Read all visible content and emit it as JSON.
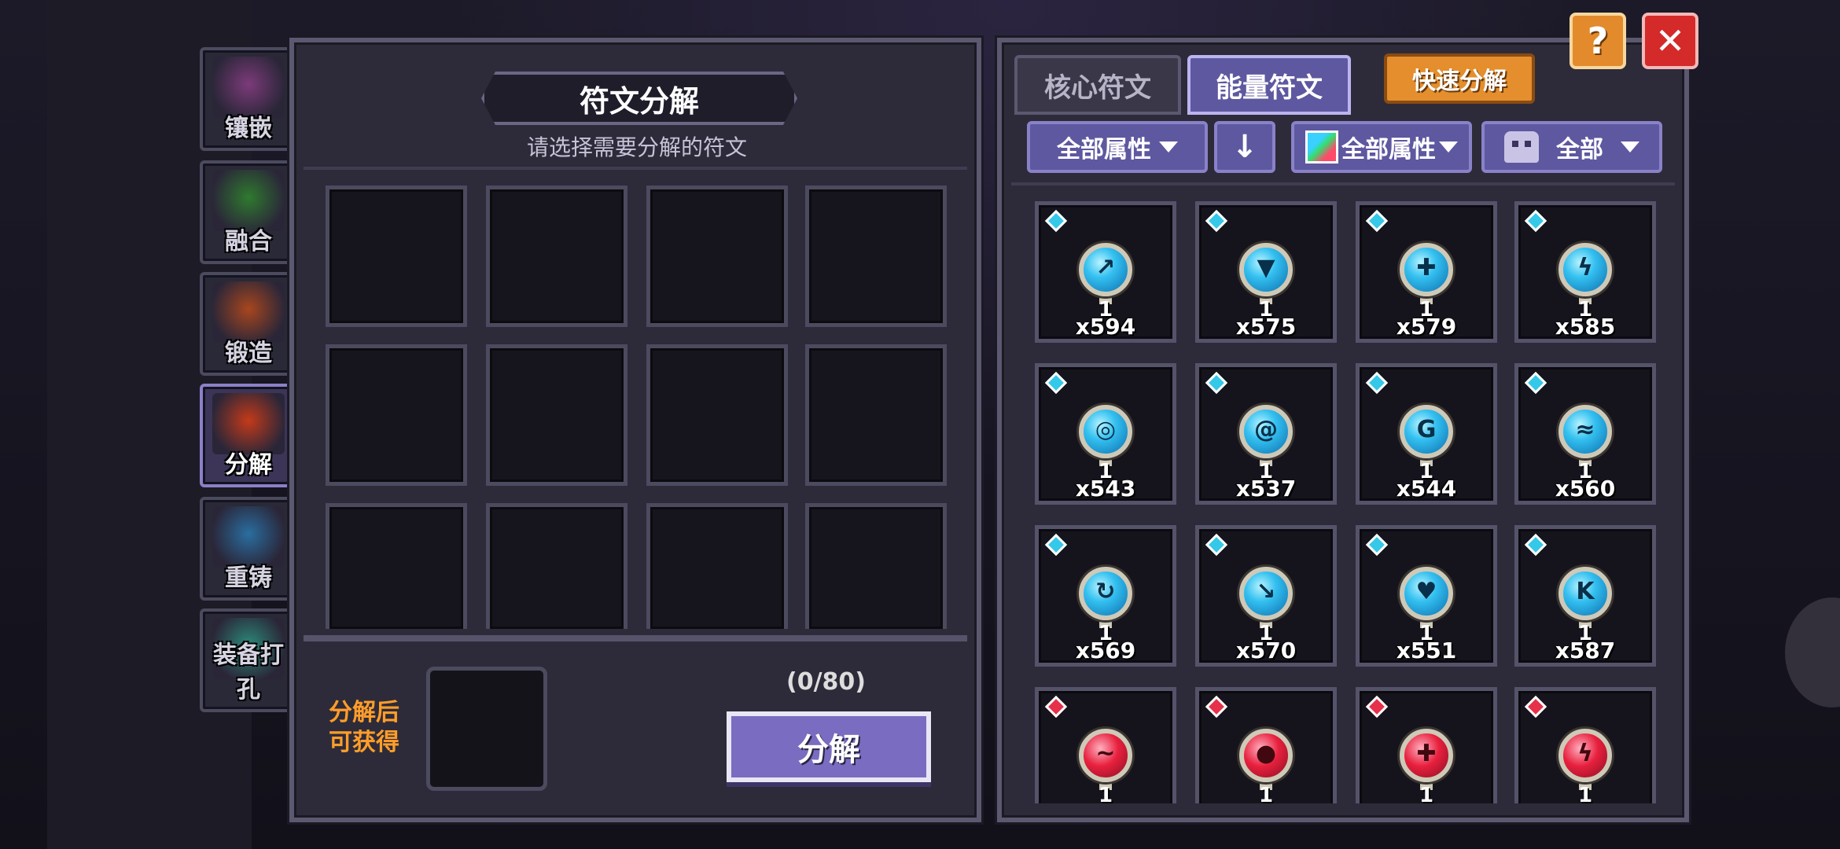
{
  "side_menu": [
    {
      "label": "镶嵌",
      "active": false,
      "color": "#7c3b7a"
    },
    {
      "label": "融合",
      "active": false,
      "color": "#2f7a2f"
    },
    {
      "label": "锻造",
      "active": false,
      "color": "#a8461e"
    },
    {
      "label": "分解",
      "active": true,
      "color": "#c43a1a"
    },
    {
      "label": "重铸",
      "active": false,
      "color": "#2a6ea0"
    },
    {
      "label": "装备打孔",
      "active": false,
      "color": "#2c8a7a"
    }
  ],
  "decompose": {
    "title": "符文分解",
    "subtitle": "请选择需要分解的符文",
    "reward_label_line1": "分解后",
    "reward_label_line2": "可获得",
    "count_text": "(0/80)",
    "button_label": "分解"
  },
  "right_panel": {
    "tab_core": "核心符文",
    "tab_energy": "能量符文",
    "quick_button": "快速分解",
    "help_label": "?",
    "close_label": "✕",
    "filter_attr": "全部属性",
    "sort_icon": "↓",
    "filter_color": "全部属性",
    "filter_type": "全部"
  },
  "runes": [
    {
      "type": "blue",
      "glyph": "↗",
      "level": "1",
      "qty": "x594"
    },
    {
      "type": "blue",
      "glyph": "▼",
      "level": "1",
      "qty": "x575"
    },
    {
      "type": "blue",
      "glyph": "✚",
      "level": "1",
      "qty": "x579"
    },
    {
      "type": "blue",
      "glyph": "ϟ",
      "level": "1",
      "qty": "x585"
    },
    {
      "type": "blue",
      "glyph": "◎",
      "level": "1",
      "qty": "x543"
    },
    {
      "type": "blue",
      "glyph": "@",
      "level": "1",
      "qty": "x537"
    },
    {
      "type": "blue",
      "glyph": "G",
      "level": "1",
      "qty": "x544"
    },
    {
      "type": "blue",
      "glyph": "≈",
      "level": "1",
      "qty": "x560"
    },
    {
      "type": "blue",
      "glyph": "↻",
      "level": "1",
      "qty": "x569"
    },
    {
      "type": "blue",
      "glyph": "↘",
      "level": "1",
      "qty": "x570"
    },
    {
      "type": "blue",
      "glyph": "♥",
      "level": "1",
      "qty": "x551"
    },
    {
      "type": "blue",
      "glyph": "K",
      "level": "1",
      "qty": "x587"
    },
    {
      "type": "red",
      "glyph": "~",
      "level": "1",
      "qty": ""
    },
    {
      "type": "red",
      "glyph": "●",
      "level": "1",
      "qty": ""
    },
    {
      "type": "red",
      "glyph": "✚",
      "level": "1",
      "qty": ""
    },
    {
      "type": "red",
      "glyph": "ϟ",
      "level": "1",
      "qty": ""
    }
  ]
}
